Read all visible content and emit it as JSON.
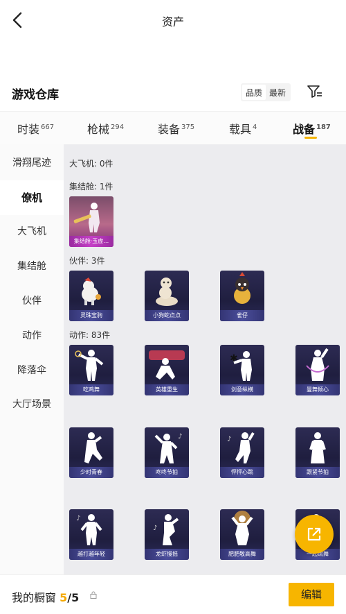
{
  "topbar": {
    "title": "资产"
  },
  "header": {
    "title": "游戏仓库",
    "sort": {
      "quality": "品质",
      "latest": "最新"
    }
  },
  "tabs": [
    {
      "label": "时装",
      "count": "667"
    },
    {
      "label": "枪械",
      "count": "294"
    },
    {
      "label": "装备",
      "count": "375"
    },
    {
      "label": "载具",
      "count": "4"
    },
    {
      "label": "战备",
      "count": "187"
    }
  ],
  "sidebar": [
    "滑翔尾迹",
    "僚机",
    "大飞机",
    "集结舱",
    "伙伴",
    "动作",
    "降落伞",
    "大厅场景"
  ],
  "sections": {
    "plane": "大飞机: 0件",
    "capsule": "集结舱: 1件",
    "partner": "伙伴: 3件",
    "emote": "动作: 83件"
  },
  "capsule_items": [
    "集结舱·玉虚…"
  ],
  "partner_items": [
    "灵珠宝驹",
    "小狗蛇点点",
    "雀仔"
  ],
  "emote_items": [
    "吃鸡舞",
    "英雄重生",
    "剑意纵横",
    "曼舞倾心",
    "少时青春",
    "咚咚节拍",
    "怦怦心跳",
    "跟紧节拍",
    "越打越年轻",
    "龙虾慢摇",
    "肥肥敬高舞",
    "一起跳舞"
  ],
  "bottom": {
    "label": "我的橱窗",
    "current": "5",
    "sep": "/",
    "total": "5",
    "edit": "编辑"
  },
  "colors": {
    "accent": "#f7b500",
    "card_bg": "#2d2b53",
    "card_label": "#4a4d9a",
    "capsule_label": "#c43fc6"
  }
}
